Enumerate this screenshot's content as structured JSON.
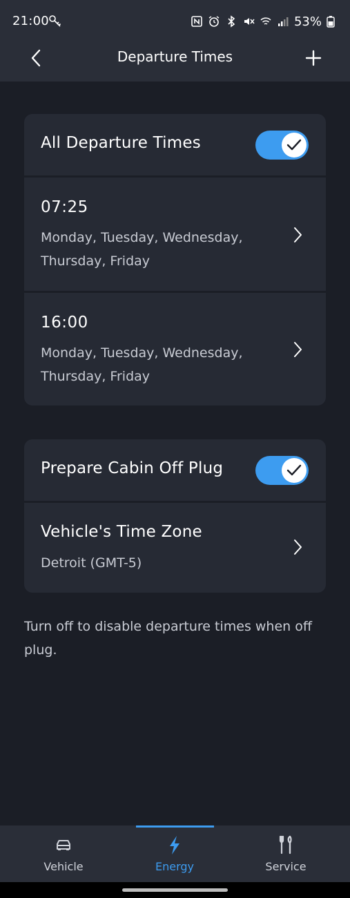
{
  "status_bar": {
    "time": "21:00",
    "battery": "53%"
  },
  "header": {
    "title": "Departure Times"
  },
  "departure_card": {
    "all_toggle_label": "All Departure Times",
    "all_toggle_on": true,
    "times": [
      {
        "time": "07:25",
        "days": "Monday, Tuesday, Wednesday, Thursday, Friday"
      },
      {
        "time": "16:00",
        "days": "Monday, Tuesday, Wednesday, Thursday, Friday"
      }
    ]
  },
  "cabin_card": {
    "prepare_label": "Prepare Cabin Off Plug",
    "prepare_on": true,
    "timezone_label": "Vehicle's Time Zone",
    "timezone_value": "Detroit (GMT-5)"
  },
  "footnote": "Turn off to disable departure times when off plug.",
  "bottom_nav": {
    "items": [
      {
        "label": "Vehicle",
        "icon": "car-icon",
        "active": false
      },
      {
        "label": "Energy",
        "icon": "lightning-icon",
        "active": true
      },
      {
        "label": "Service",
        "icon": "tools-icon",
        "active": false
      }
    ]
  },
  "colors": {
    "accent": "#3d9cf0",
    "background": "#1b1e26",
    "card": "#262a34",
    "header": "#2a2e38"
  }
}
